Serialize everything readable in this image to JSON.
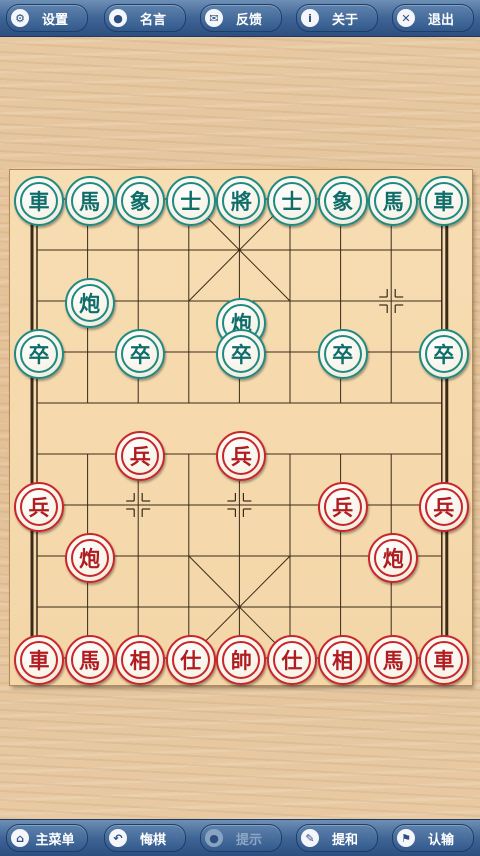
{
  "top_bar": {
    "buttons": [
      {
        "icon": "gear-icon",
        "glyph": "⚙",
        "label": "设置"
      },
      {
        "icon": "chat-bubble-icon",
        "glyph": "●",
        "label": "名言"
      },
      {
        "icon": "mail-icon",
        "glyph": "✉",
        "label": "反馈"
      },
      {
        "icon": "info-icon",
        "glyph": "i",
        "label": "关于"
      },
      {
        "icon": "close-icon",
        "glyph": "✕",
        "label": "退出"
      }
    ]
  },
  "bottom_bar": {
    "buttons": [
      {
        "icon": "home-icon",
        "glyph": "⌂",
        "label": "主菜单"
      },
      {
        "icon": "undo-icon",
        "glyph": "↶",
        "label": "悔棋"
      },
      {
        "icon": "lightbulb-icon",
        "glyph": "●",
        "label": "提示",
        "disabled": true
      },
      {
        "icon": "pencil-icon",
        "glyph": "✎",
        "label": "提和"
      },
      {
        "icon": "flag-icon",
        "glyph": "⚑",
        "label": "认输"
      }
    ]
  },
  "board": {
    "river_left": "",
    "river_right": "",
    "marker_points": [
      [
        7,
        2
      ]
    ],
    "pieces": [
      {
        "side": "black",
        "char": "車",
        "file": 0,
        "rank": 0
      },
      {
        "side": "black",
        "char": "馬",
        "file": 1,
        "rank": 0
      },
      {
        "side": "black",
        "char": "象",
        "file": 2,
        "rank": 0
      },
      {
        "side": "black",
        "char": "士",
        "file": 3,
        "rank": 0
      },
      {
        "side": "black",
        "char": "將",
        "file": 4,
        "rank": 0
      },
      {
        "side": "black",
        "char": "士",
        "file": 5,
        "rank": 0
      },
      {
        "side": "black",
        "char": "象",
        "file": 6,
        "rank": 0
      },
      {
        "side": "black",
        "char": "馬",
        "file": 7,
        "rank": 0
      },
      {
        "side": "black",
        "char": "車",
        "file": 8,
        "rank": 0
      },
      {
        "side": "black",
        "char": "炮",
        "file": 1,
        "rank": 2
      },
      {
        "side": "black",
        "char": "炮",
        "file": 4,
        "rank": 2.4
      },
      {
        "side": "black",
        "char": "卒",
        "file": 0,
        "rank": 3
      },
      {
        "side": "black",
        "char": "卒",
        "file": 2,
        "rank": 3
      },
      {
        "side": "black",
        "char": "卒",
        "file": 4,
        "rank": 3
      },
      {
        "side": "black",
        "char": "卒",
        "file": 6,
        "rank": 3
      },
      {
        "side": "black",
        "char": "卒",
        "file": 8,
        "rank": 3
      },
      {
        "side": "red",
        "char": "兵",
        "file": 2,
        "rank": 5
      },
      {
        "side": "red",
        "char": "兵",
        "file": 4,
        "rank": 5
      },
      {
        "side": "red",
        "char": "兵",
        "file": 0,
        "rank": 6
      },
      {
        "side": "red",
        "char": "兵",
        "file": 6,
        "rank": 6
      },
      {
        "side": "red",
        "char": "兵",
        "file": 8,
        "rank": 6
      },
      {
        "side": "red",
        "char": "炮",
        "file": 1,
        "rank": 7
      },
      {
        "side": "red",
        "char": "炮",
        "file": 7,
        "rank": 7
      },
      {
        "side": "red",
        "char": "車",
        "file": 0,
        "rank": 9
      },
      {
        "side": "red",
        "char": "馬",
        "file": 1,
        "rank": 9
      },
      {
        "side": "red",
        "char": "相",
        "file": 2,
        "rank": 9
      },
      {
        "side": "red",
        "char": "仕",
        "file": 3,
        "rank": 9
      },
      {
        "side": "red",
        "char": "帥",
        "file": 4,
        "rank": 9
      },
      {
        "side": "red",
        "char": "仕",
        "file": 5,
        "rank": 9
      },
      {
        "side": "red",
        "char": "相",
        "file": 6,
        "rank": 9
      },
      {
        "side": "red",
        "char": "馬",
        "file": 7,
        "rank": 9
      },
      {
        "side": "red",
        "char": "車",
        "file": 8,
        "rank": 9
      }
    ]
  }
}
